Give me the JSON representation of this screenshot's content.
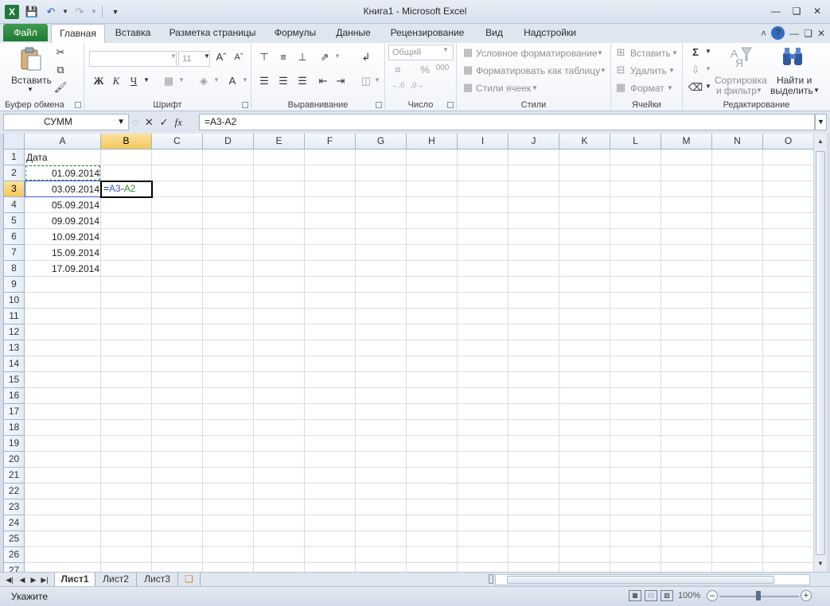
{
  "window": {
    "title": "Книга1  -  Microsoft Excel",
    "app_icon": "X",
    "qat_icons": [
      "save-icon",
      "undo-icon",
      "redo-icon",
      "customize-icon"
    ]
  },
  "tabs": {
    "file": "Файл",
    "items": [
      "Главная",
      "Вставка",
      "Разметка страницы",
      "Формулы",
      "Данные",
      "Рецензирование",
      "Вид",
      "Надстройки"
    ],
    "active": "Главная"
  },
  "ribbon": {
    "clipboard": {
      "label": "Буфер обмена",
      "paste": "Вставить"
    },
    "font": {
      "label": "Шрифт",
      "font_name": "",
      "font_size": "11",
      "bold": "Ж",
      "italic": "К",
      "underline": "Ч"
    },
    "alignment": {
      "label": "Выравнивание"
    },
    "number": {
      "label": "Число",
      "format": "Общий"
    },
    "styles": {
      "label": "Стили",
      "conditional": "Условное форматирование",
      "as_table": "Форматировать как таблицу",
      "cell_styles": "Стили ячеек"
    },
    "cells": {
      "label": "Ячейки",
      "insert": "Вставить",
      "delete": "Удалить",
      "format": "Формат"
    },
    "editing": {
      "label": "Редактирование",
      "sort": "Сортировка",
      "sort2": "и фильтр",
      "find": "Найти и",
      "find2": "выделить"
    }
  },
  "formula_bar": {
    "name_box": "СУММ",
    "fx": "fx",
    "formula": "=A3-A2"
  },
  "sheet": {
    "columns": [
      "A",
      "B",
      "C",
      "D",
      "E",
      "F",
      "G",
      "H",
      "I",
      "J",
      "K",
      "L",
      "M",
      "N",
      "O"
    ],
    "rows": [
      "1",
      "2",
      "3",
      "4",
      "5",
      "6",
      "7",
      "8",
      "9",
      "10",
      "11",
      "12",
      "13",
      "14",
      "15",
      "16",
      "17",
      "18",
      "19",
      "20",
      "21",
      "22",
      "23",
      "24",
      "25",
      "26",
      "27"
    ],
    "selected_column": "B",
    "selected_row": "3",
    "cells": {
      "A1": "Дата",
      "A2": "01.09.2014",
      "A3": "03.09.2014",
      "A4": "05.09.2014",
      "A5": "09.09.2014",
      "A6": "10.09.2014",
      "A7": "15.09.2014",
      "A8": "17.09.2014"
    },
    "editing_cell": {
      "prefix": "=",
      "ref1": "A3",
      "op": "-",
      "ref2": "A2"
    }
  },
  "sheet_tabs": [
    "Лист1",
    "Лист2",
    "Лист3"
  ],
  "active_sheet": "Лист1",
  "status": {
    "mode": "Укажите",
    "zoom": "100%"
  }
}
